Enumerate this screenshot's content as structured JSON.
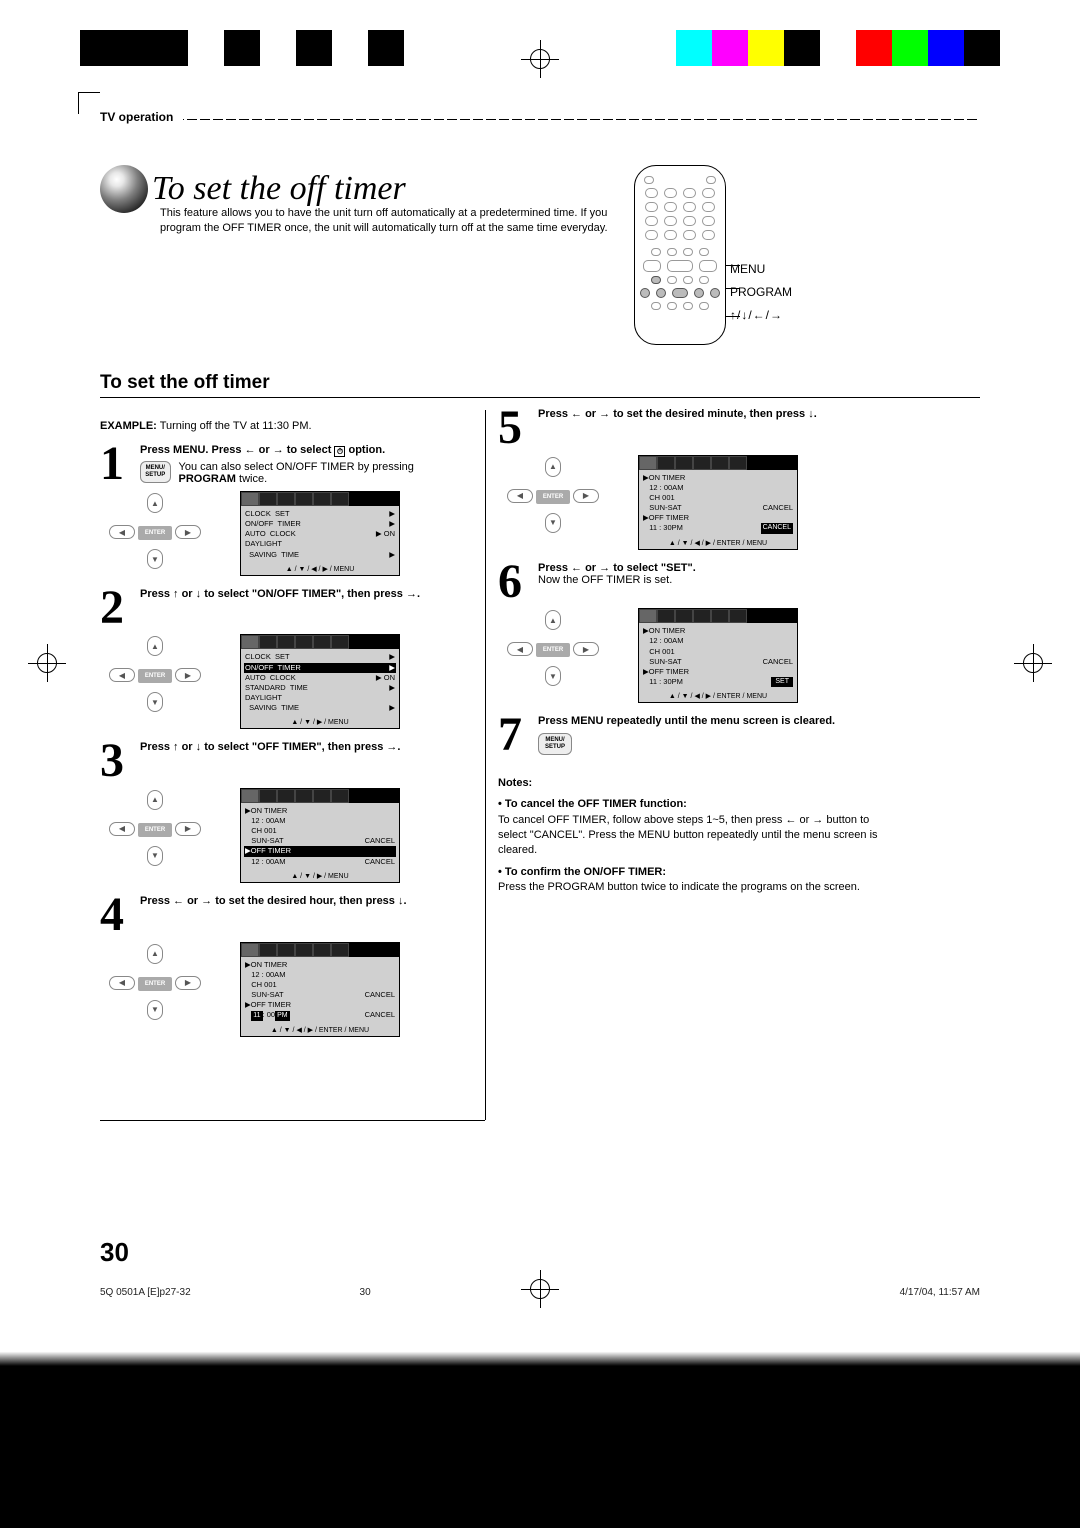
{
  "header": {
    "section": "TV operation"
  },
  "title": "To set the off timer",
  "intro": "This feature allows you to have the unit turn off automatically at a predetermined time. If you program the OFF TIMER once, the unit will automatically turn off at the same time everyday.",
  "remote": {
    "label_menu": "MENU",
    "label_program": "PROGRAM",
    "label_arrows": "↕ / ↔ / ← / →"
  },
  "section_heading": "To set the off timer",
  "example_label": "EXAMPLE:",
  "example_text": "Turning off the TV at 11:30 PM.",
  "steps": {
    "s1": {
      "num": "1",
      "bold": "Press MENU. Press ← or → to select ⧈ option.",
      "line2": "You can also select ON/OFF TIMER by pressing ",
      "line2_bold": "PROGRAM",
      "line2_tail": " twice.",
      "menubtn": "MENU/\nSETUP",
      "osd": {
        "rows": [
          [
            "CLOCK  SET",
            "▶"
          ],
          [
            "ON/OFF  TIMER",
            "▶"
          ],
          [
            "AUTO  CLOCK",
            "▶ ON"
          ],
          [
            "DAYLIGHT",
            ""
          ],
          [
            "  SAVING  TIME",
            "▶"
          ]
        ],
        "foot": "▲ / ▼ / ◀ / ▶ / MENU"
      }
    },
    "s2": {
      "num": "2",
      "bold": "Press ↑ or ↓ to select \"ON/OFF TIMER\", then press →.",
      "osd": {
        "rows": [
          [
            "CLOCK  SET",
            "▶"
          ],
          [
            "ON/OFF  TIMER",
            "▶",
            "hl"
          ],
          [
            "AUTO  CLOCK",
            "▶ ON"
          ],
          [
            "STANDARD  TIME",
            "▶"
          ],
          [
            "DAYLIGHT",
            ""
          ],
          [
            "  SAVING  TIME",
            "▶"
          ]
        ],
        "foot": "▲ / ▼ / ▶ / MENU"
      }
    },
    "s3": {
      "num": "3",
      "bold": "Press ↑ or ↓ to select \"OFF TIMER\", then press →.",
      "osd": {
        "rows": [
          [
            "▶ON TIMER",
            ""
          ],
          [
            "    12 : 00AM",
            ""
          ],
          [
            "    CH 001",
            ""
          ],
          [
            "    SUN-SAT",
            "CANCEL"
          ],
          [
            "▶OFF TIMER",
            "",
            "hl"
          ],
          [
            "    12 : 00AM",
            "CANCEL"
          ]
        ],
        "foot": "▲ / ▼ / ▶ / MENU"
      }
    },
    "s4": {
      "num": "4",
      "bold": "Press ← or → to set the desired hour, then press ↓.",
      "osd": {
        "rows": [
          [
            "▶ON TIMER",
            ""
          ],
          [
            "    12 : 00AM",
            ""
          ],
          [
            "    CH 001",
            ""
          ],
          [
            "    SUN-SAT",
            "CANCEL"
          ],
          [
            "▶OFF TIMER",
            ""
          ],
          [
            "    ⬛11⬛: 00PM",
            "CANCEL",
            "time"
          ]
        ],
        "foot": "▲ / ▼ / ◀ / ▶ / ENTER / MENU"
      }
    },
    "s5": {
      "num": "5",
      "bold": "Press ← or → to set the desired minute, then press ↓.",
      "osd": {
        "rows": [
          [
            "▶ON TIMER",
            ""
          ],
          [
            "    12 : 00AM",
            ""
          ],
          [
            "    CH 001",
            ""
          ],
          [
            "    SUN-SAT",
            "CANCEL"
          ],
          [
            "▶OFF TIMER",
            ""
          ],
          [
            "    11 : 30PM",
            "⬛CANCEL⬛",
            "cancel"
          ]
        ],
        "foot": "▲ / ▼ / ◀ / ▶ / ENTER / MENU"
      }
    },
    "s6": {
      "num": "6",
      "bold": "Press ← or → to select \"SET\".",
      "sub": "Now the OFF TIMER is set.",
      "osd": {
        "rows": [
          [
            "▶ON TIMER",
            ""
          ],
          [
            "    12 : 00AM",
            ""
          ],
          [
            "    CH 001",
            ""
          ],
          [
            "    SUN-SAT",
            "CANCEL"
          ],
          [
            "▶OFF TIMER",
            ""
          ],
          [
            "    11 : 30PM",
            "⬛SET⬛",
            "set"
          ]
        ],
        "foot": "▲ / ▼ / ◀ / ▶ / ENTER / MENU"
      }
    },
    "s7": {
      "num": "7",
      "bold": "Press MENU repeatedly until the menu screen is cleared.",
      "menubtn": "MENU/\nSETUP"
    }
  },
  "notes": {
    "heading": "Notes:",
    "n1_title": "To cancel the OFF TIMER function:",
    "n1_body": "To cancel OFF TIMER, follow above steps 1~5, then press ← or → button to select \"CANCEL\". Press the MENU button repeatedly until the menu screen is cleared.",
    "n2_title": "To confirm the ON/OFF TIMER:",
    "n2_body": "Press the PROGRAM button twice to indicate the programs on the screen."
  },
  "pagenum": "30",
  "footer": {
    "left": "5Q  0501A [E]p27-32",
    "mid": "30",
    "right": "4/17/04, 11:57 AM"
  },
  "dpad": {
    "enter": "ENTER"
  }
}
